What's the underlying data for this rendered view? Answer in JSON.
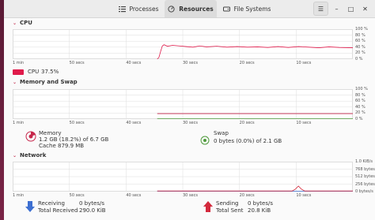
{
  "tabs": [
    {
      "label": "Processes",
      "icon": "list-icon",
      "active": false
    },
    {
      "label": "Resources",
      "icon": "gauge-icon",
      "active": true
    },
    {
      "label": "File Systems",
      "icon": "drive-icon",
      "active": false
    }
  ],
  "window_controls": {
    "menu": "☰",
    "minimize": "–",
    "maximize": "□",
    "close": "✕"
  },
  "cpu": {
    "title": "CPU",
    "y_ticks": [
      "100 %",
      "80 %",
      "60 %",
      "40 %",
      "20 %",
      "0 %"
    ],
    "x_ticks": [
      "1 min",
      "50 secs",
      "40 secs",
      "30 secs",
      "20 secs",
      "10 secs"
    ],
    "legend_label": "CPU",
    "legend_value": "37.5%",
    "color": "#e01b4b",
    "series": [
      [
        0.425,
        0
      ],
      [
        0.43,
        6
      ],
      [
        0.435,
        26
      ],
      [
        0.44,
        44
      ],
      [
        0.445,
        48
      ],
      [
        0.455,
        43
      ],
      [
        0.47,
        46
      ],
      [
        0.49,
        44
      ],
      [
        0.51,
        42
      ],
      [
        0.53,
        40
      ],
      [
        0.55,
        44
      ],
      [
        0.57,
        41
      ],
      [
        0.6,
        43
      ],
      [
        0.63,
        40
      ],
      [
        0.66,
        42
      ],
      [
        0.69,
        40
      ],
      [
        0.72,
        41
      ],
      [
        0.75,
        39
      ],
      [
        0.78,
        42
      ],
      [
        0.81,
        39
      ],
      [
        0.84,
        42
      ],
      [
        0.87,
        40
      ],
      [
        0.9,
        38
      ],
      [
        0.93,
        41
      ],
      [
        0.96,
        39
      ],
      [
        1.0,
        38
      ]
    ]
  },
  "memory": {
    "title": "Memory and Swap",
    "y_ticks": [
      "100 %",
      "80 %",
      "60 %",
      "40 %",
      "20 %",
      "0 %"
    ],
    "x_ticks": [
      "1 min",
      "50 secs",
      "40 secs",
      "30 secs",
      "20 secs",
      "10 secs"
    ],
    "memory_label": "Memory",
    "memory_line1": "1.2 GB (18.2%) of 6.7 GB",
    "memory_line2": "Cache 879.9 MB",
    "swap_label": "Swap",
    "swap_line1": "0 bytes (0.0%) of 2.1 GB",
    "memory_color": "#c6264b",
    "swap_color": "#4e9a3b",
    "memory_percent": 18.2,
    "swap_percent": 0
  },
  "network": {
    "title": "Network",
    "y_ticks": [
      "1.0 KiB/s",
      "768 bytes/s",
      "512 bytes/s",
      "256 bytes/s",
      "0 bytes/s"
    ],
    "x_ticks": [
      "1 min",
      "50 secs",
      "40 secs",
      "30 secs",
      "20 secs",
      "10 secs"
    ],
    "receiving_label": "Receiving",
    "receiving_value": "0 bytes/s",
    "total_received_label": "Total Received",
    "total_received_value": "290.0 KiB",
    "sending_label": "Sending",
    "sending_value": "0 bytes/s",
    "total_sent_label": "Total Sent",
    "total_sent_value": "20.8 KiB",
    "receiving_color": "#3d6fd1",
    "sending_color": "#d3293c"
  }
}
